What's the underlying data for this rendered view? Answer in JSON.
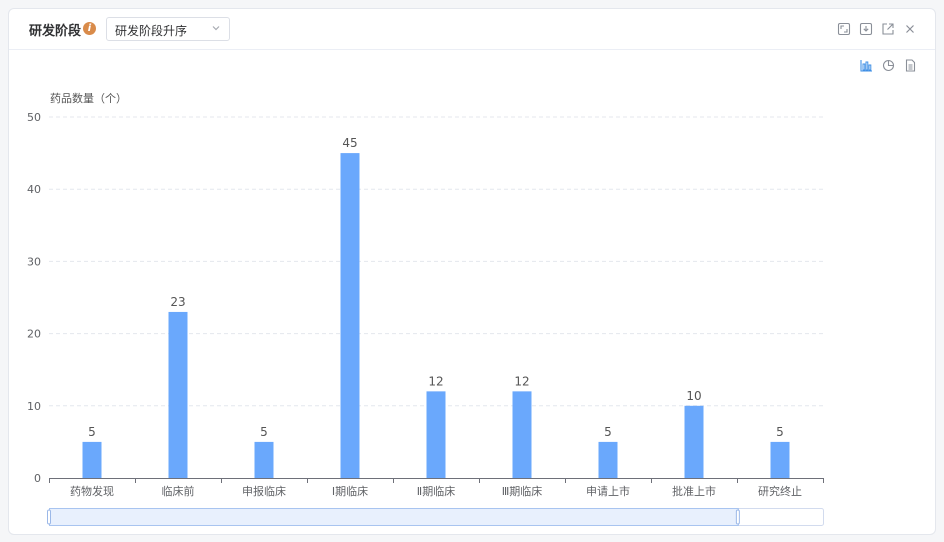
{
  "header": {
    "title": "研发阶段",
    "info_icon": "info-icon",
    "sort_select": {
      "value": "研发阶段升序"
    },
    "window_icons": [
      "fullscreen-icon",
      "download-icon",
      "external-link-icon",
      "close-icon"
    ]
  },
  "view_icons": [
    "bar-chart-icon",
    "pie-chart-icon",
    "document-icon"
  ],
  "colors": {
    "bar": "#6aa8fc",
    "bar_border": "#5795ef",
    "accent": "#3f8fe5",
    "slider_fill": "#e8f0fd"
  },
  "chart_data": {
    "type": "bar",
    "ylabel": "药品数量（个）",
    "categories": [
      "药物发现",
      "临床前",
      "申报临床",
      "Ⅰ期临床",
      "Ⅱ期临床",
      "Ⅲ期临床",
      "申请上市",
      "批准上市",
      "研究终止"
    ],
    "values": [
      5,
      23,
      5,
      45,
      12,
      12,
      5,
      10,
      5
    ],
    "yticks": [
      "0",
      "10",
      "20",
      "30",
      "40",
      "50"
    ],
    "ylim": [
      0,
      50
    ],
    "grid": true,
    "data_labels": true,
    "zoom_slider": {
      "start": 0,
      "end": 0.89
    }
  }
}
